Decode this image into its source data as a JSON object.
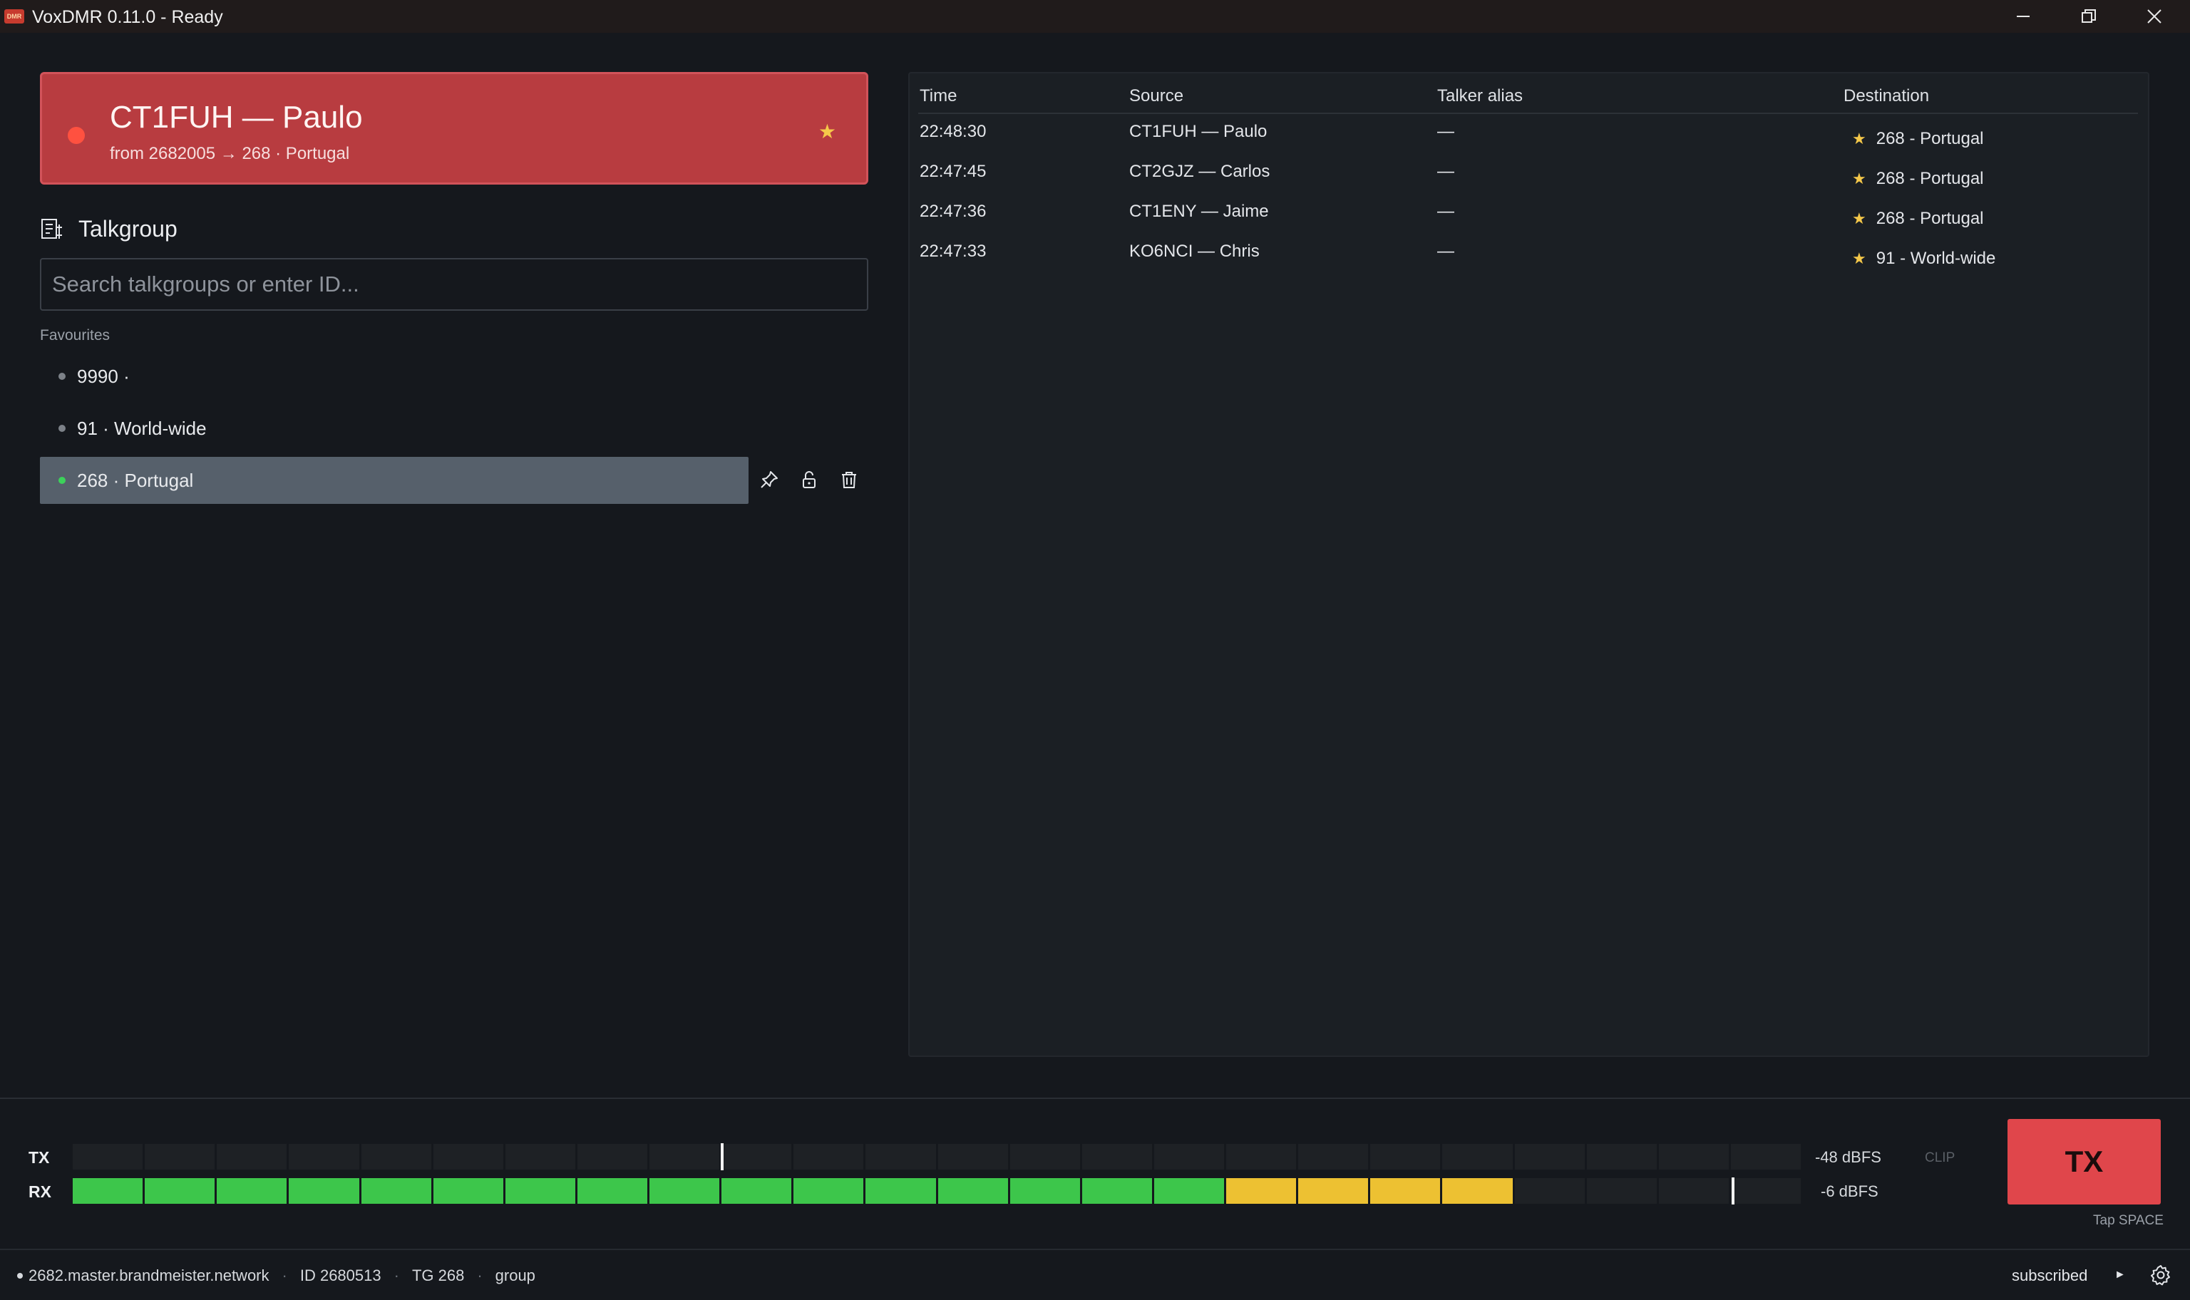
{
  "window": {
    "title": "VoxDMR 0.11.0 - Ready",
    "logo_text": "DMR"
  },
  "now_playing": {
    "title": "CT1FUH — Paulo",
    "subtitle": "from 2682005 → 268 · Portugal",
    "favourite": true
  },
  "talkgroup": {
    "title": "Talkgroup",
    "search_placeholder": "Search talkgroups or enter ID...",
    "favourites_label": "Favourites",
    "items": [
      {
        "label": "9990 ·",
        "selected": false
      },
      {
        "label": "91 · World-wide",
        "selected": false
      },
      {
        "label": "268 · Portugal",
        "selected": true
      }
    ],
    "actions": [
      "pin-icon",
      "unlock-icon",
      "trash-icon"
    ]
  },
  "history": {
    "columns": [
      "Time",
      "Source",
      "Talker alias",
      "Destination"
    ],
    "rows": [
      {
        "time": "22:48:30",
        "source": "CT1FUH — Paulo",
        "alias": "—",
        "destination": "268 - Portugal"
      },
      {
        "time": "22:47:45",
        "source": "CT2GJZ — Carlos",
        "alias": "—",
        "destination": "268 - Portugal"
      },
      {
        "time": "22:47:36",
        "source": "CT1ENY — Jaime",
        "alias": "—",
        "destination": "268 - Portugal"
      },
      {
        "time": "22:47:33",
        "source": "KO6NCI — Chris",
        "alias": "—",
        "destination": "91 - World-wide"
      }
    ]
  },
  "meters": {
    "segments": 24,
    "tx": {
      "label": "TX",
      "level_dbfs": "-48 dBFS",
      "lit_segments": 0,
      "peak_fraction": 0.375
    },
    "rx": {
      "label": "RX",
      "level_dbfs": "-6 dBFS",
      "green_segments": 16,
      "yellow_segments": 4,
      "peak_fraction": 0.96
    },
    "clip_label": "CLIP",
    "colors": {
      "green": "#3dc64b",
      "yellow": "#edc132",
      "off": "#1e2125"
    }
  },
  "tx_button": {
    "label": "TX",
    "hint": "Tap SPACE",
    "color": "#e0464b"
  },
  "status_bar": {
    "server": "2682.master.brandmeister.network",
    "id": "ID 2680513",
    "tg": "TG 268",
    "mode": "group",
    "state": "subscribed"
  }
}
